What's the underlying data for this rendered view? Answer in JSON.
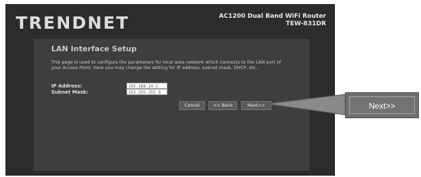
{
  "header": {
    "logo_text": "TRENDNET",
    "product_line1": "AC1200 Dual Band WiFi Router",
    "product_line2": "TEW-831DR"
  },
  "page": {
    "title": "LAN Interface Setup",
    "description": "This page is used to configure the parameters for local area network which connects to the LAN port of your Access Point. Here you may change the setting for IP address, subnet mask, DHCP, etc.."
  },
  "fields": {
    "ip_label": "IP Address:",
    "ip_value": "192.168.10.1",
    "mask_label": "Subnet Mask:",
    "mask_value": "255.255.255.0"
  },
  "buttons": {
    "cancel": "Cancel",
    "back": "<< Back",
    "next": "Next>>"
  },
  "callout": {
    "label": "Next>>"
  }
}
